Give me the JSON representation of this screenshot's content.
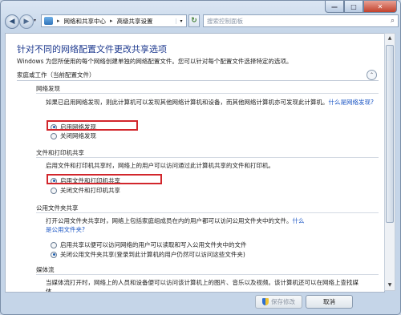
{
  "titlebar": {
    "minimize": "—",
    "maximize": "□",
    "close": "✕"
  },
  "nav": {
    "back": "◀",
    "forward": "▶",
    "dropdown": "▾",
    "breadcrumbs": [
      "网络和共享中心",
      "高级共享设置"
    ],
    "crumb_separator": "▸",
    "refresh": "↻",
    "search_placeholder": "搜索控制面板",
    "search_icon": "⌕"
  },
  "page": {
    "title": "针对不同的网络配置文件更改共享选项",
    "description": "Windows 为您所使用的每个网络创建单独的网络配置文件。您可以针对每个配置文件选择特定的选项。",
    "profile_label": "家庭或工作（当前配置文件）",
    "collapse_icon": "⌃"
  },
  "sections": {
    "network_discovery": {
      "title": "网络发现",
      "description": "如果已启用网络发现，则此计算机可以发现其他网络计算机和设备，而其他网络计算机亦可发现此计算机。",
      "link": "什么是网络发现?",
      "options": [
        "启用网络发现",
        "关闭网络发现"
      ],
      "selected": 0
    },
    "file_printer_sharing": {
      "title": "文件和打印机共享",
      "description": "启用文件和打印机共享时，网络上的用户可以访问通过此计算机共享的文件和打印机。",
      "options": [
        "启用文件和打印机共享",
        "关闭文件和打印机共享"
      ],
      "selected": 0
    },
    "public_folder_sharing": {
      "title": "公用文件夹共享",
      "description": "打开公用文件夹共享时，网络上包括家庭组成员在内的用户都可以访问公用文件夹中的文件。",
      "link_inline": "什么",
      "link": "是公用文件夹?",
      "options": [
        "启用共享以便可以访问网络的用户可以读取和写入公用文件夹中的文件",
        "关闭公用文件夹共享(登录到此计算机的用户仍然可以访问这些文件夹)"
      ],
      "selected": 1
    },
    "media_streaming": {
      "title": "媒体流",
      "description": "当媒体流打开时，网络上的人员和设备便可以访问该计算机上的图片、音乐以及视频。该计算机还可以在网络上查找媒体。"
    }
  },
  "footer": {
    "save_label": "保存修改",
    "cancel_label": "取消"
  },
  "scrollbar": {
    "up": "▲",
    "down": "▼"
  },
  "colors": {
    "highlight": "#d2262c",
    "title": "#1e3a8f",
    "link": "#1a55c4"
  }
}
